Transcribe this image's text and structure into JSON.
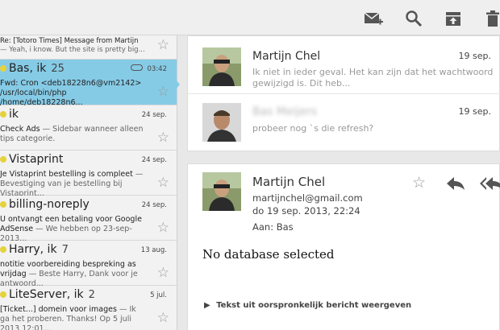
{
  "toolbar": {
    "compose": "compose-icon",
    "search": "search-icon",
    "archive": "archive-icon",
    "delete": "trash-icon"
  },
  "conversations": [
    {
      "subject": "Re: [Totoro Times] Message from Martijn",
      "snippet": "— Yeah, i know. But the site is pretty big..."
    },
    {
      "sender": "Bas, ik",
      "count": "25",
      "date": "03:42",
      "subject": "Fwd: Cron <deb18228n6@vm2142> /usr/local/bin/php /home/deb18228n6..."
    },
    {
      "sender": "ik",
      "date": "24 sep.",
      "subject": "Check Ads",
      "snippet": " — Sidebar wanneer alleen tips categorie."
    },
    {
      "sender": "Vistaprint",
      "date": "24 sep.",
      "subject": "Je Vistaprint bestelling is compleet",
      "snippet": " — Bevestiging van je bestelling bij Vistaprint..."
    },
    {
      "sender": "billing-noreply",
      "date": "24 sep.",
      "subject": "U ontvangt een betaling voor Google AdSense",
      "snippet": " — We hebben op 23-sep-2013..."
    },
    {
      "sender": "Harry, ik",
      "count": "7",
      "date": "13 aug.",
      "subject": "notitie voorbereiding bespreking as vrijdag",
      "snippet": " — Beste Harry, Dank voor je antwoord..."
    },
    {
      "sender": "LiteServer, ik",
      "count": "2",
      "date": "5 jul.",
      "subject": "[Ticket...] domein voor images",
      "snippet": " — Ik ga het proberen. Thanks! Op 5 juli 2013 12:01..."
    }
  ],
  "thread": {
    "messages": [
      {
        "name": "Martijn Chel",
        "date": "19 sep.",
        "preview": "Ik niet in ieder geval. Het kan zijn dat het wachtwoord gewijzigd is. Dit heb..."
      },
      {
        "name": "Bas Meijers",
        "date": "19 sep.",
        "preview": "probeer nog `s die refresh?"
      }
    ],
    "open": {
      "name": "Martijn Chel",
      "email": "martijnchel@gmail.com",
      "datetime": "do 19 sep. 2013, 22:24",
      "to": "Aan: Bas",
      "body": "No database selected",
      "show_original": "Tekst uit oorspronkelijk bericht weergeven"
    }
  }
}
